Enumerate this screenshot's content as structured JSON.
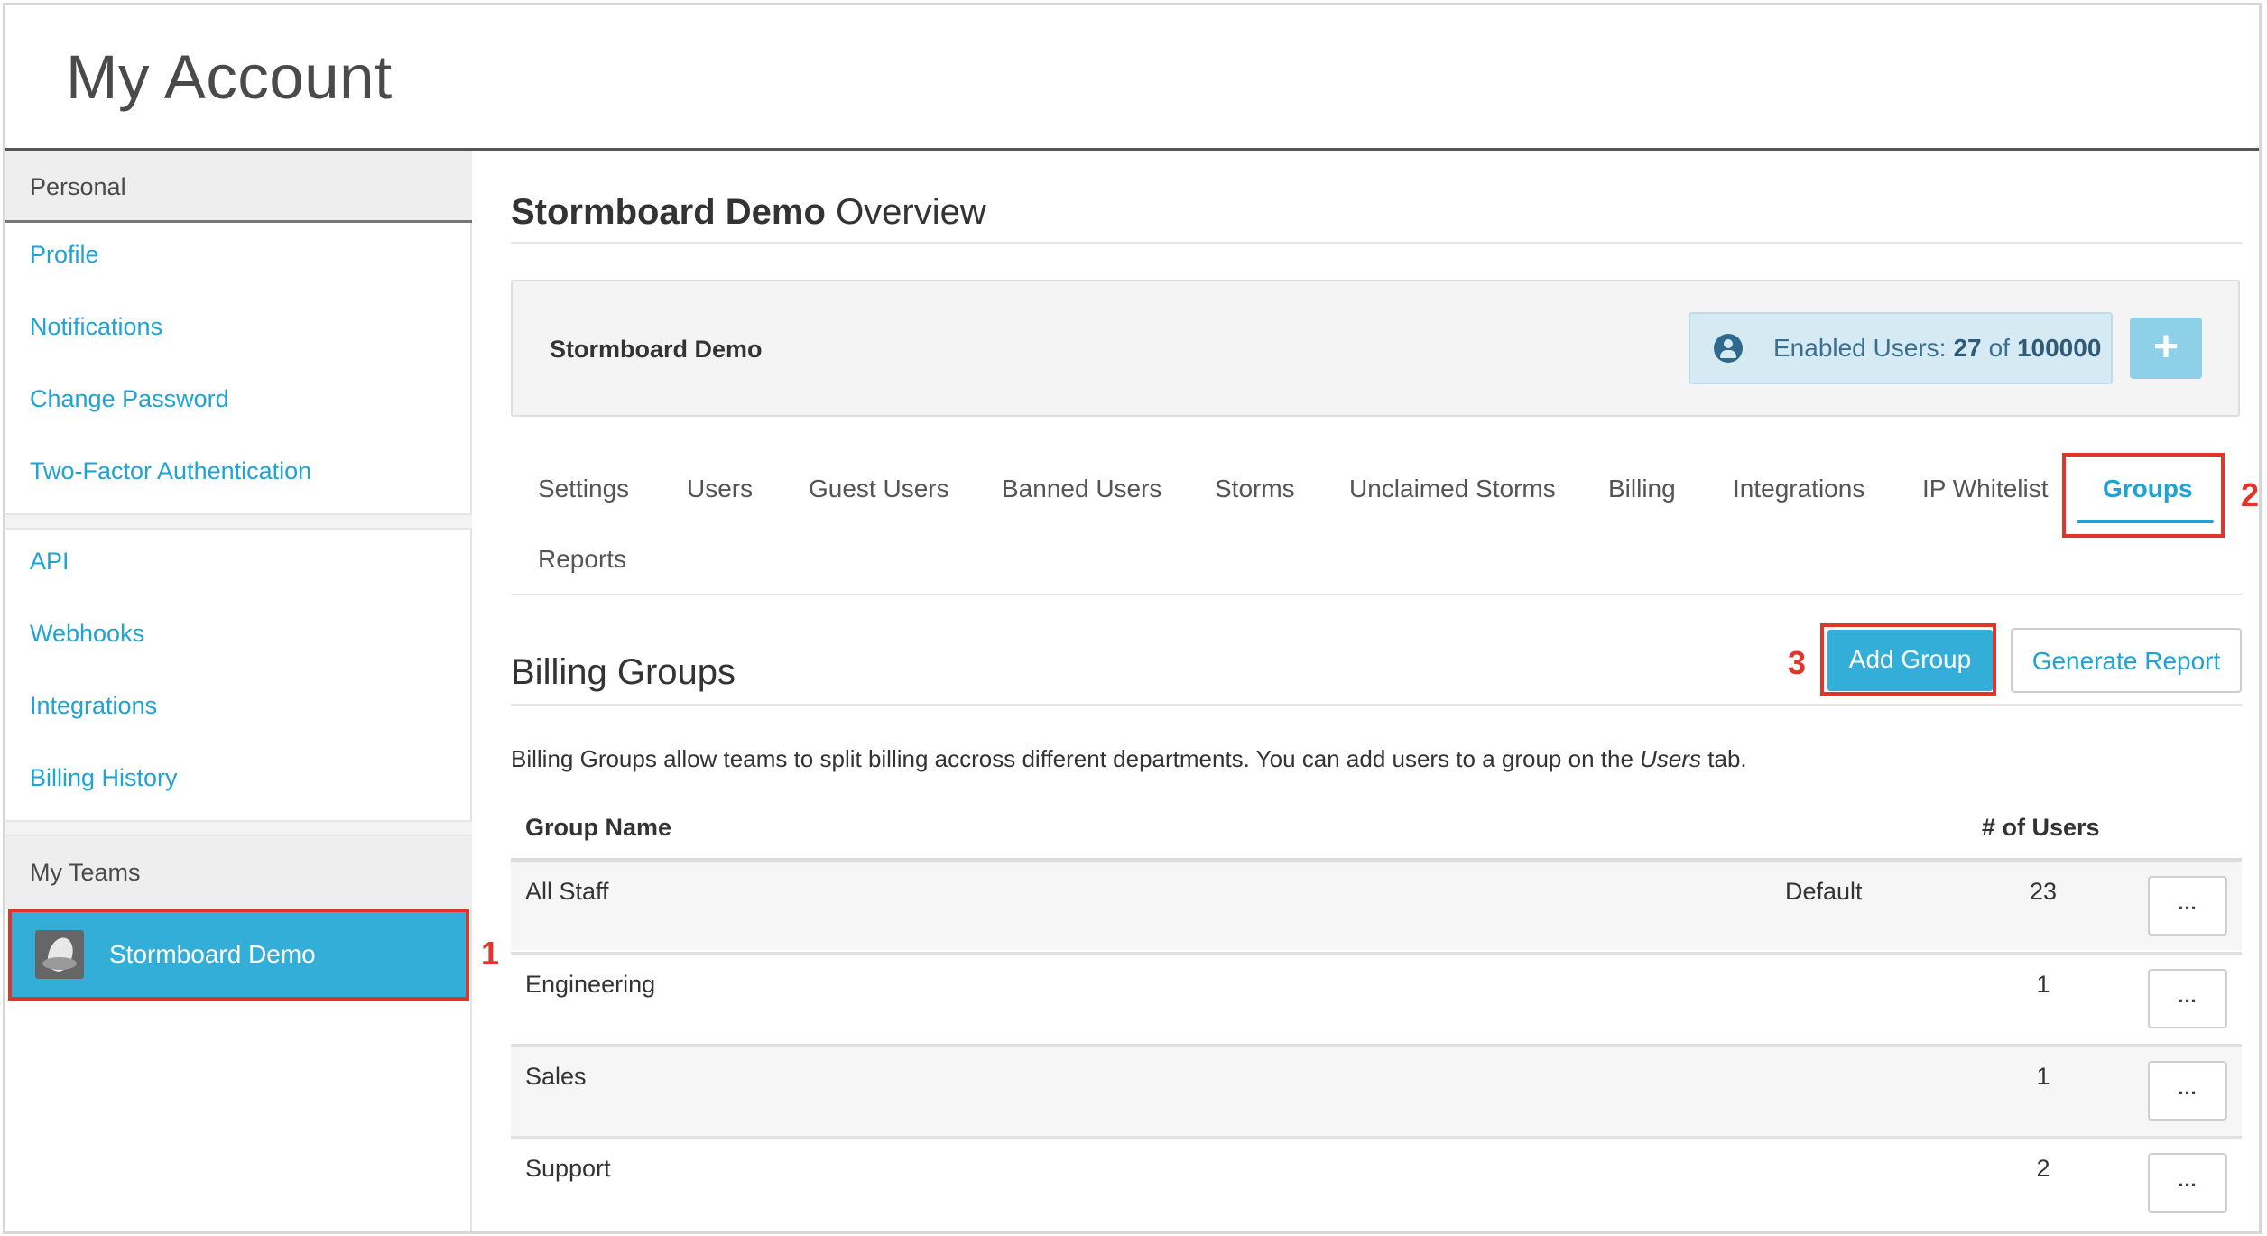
{
  "page": {
    "title": "My Account"
  },
  "sidebar": {
    "personal_header": "Personal",
    "personal_links": [
      "Profile",
      "Notifications",
      "Change Password",
      "Two-Factor Authentication"
    ],
    "dev_links": [
      "API",
      "Webhooks",
      "Integrations",
      "Billing History"
    ],
    "teams_header": "My Teams",
    "active_team": "Stormboard Demo"
  },
  "main": {
    "title_bold": "Stormboard Demo",
    "title_rest": "Overview",
    "summary": {
      "team_name": "Stormboard Demo",
      "enabled_label": "Enabled Users:",
      "enabled_count": "27",
      "of_label": "of",
      "enabled_total": "100000",
      "add_icon": "+"
    },
    "tabs": [
      "Settings",
      "Users",
      "Guest Users",
      "Banned Users",
      "Storms",
      "Unclaimed Storms",
      "Billing",
      "Integrations",
      "IP Whitelist",
      "Groups",
      "Reports"
    ],
    "active_tab": "Groups",
    "section_title": "Billing Groups",
    "add_group_label": "Add Group",
    "generate_report_label": "Generate Report",
    "description_pre": "Billing Groups allow teams to split billing accross different departments. You can add users to a group on the ",
    "description_em": "Users",
    "description_post": " tab.",
    "table": {
      "headers": {
        "name": "Group Name",
        "users": "# of Users"
      },
      "rows": [
        {
          "name": "All Staff",
          "tag": "Default",
          "users": "23",
          "menu": "..."
        },
        {
          "name": "Engineering",
          "tag": "",
          "users": "1",
          "menu": "..."
        },
        {
          "name": "Sales",
          "tag": "",
          "users": "1",
          "menu": "..."
        },
        {
          "name": "Support",
          "tag": "",
          "users": "2",
          "menu": "..."
        }
      ]
    }
  },
  "callouts": [
    "1",
    "2",
    "3"
  ],
  "colors": {
    "accent": "#33aed9",
    "link": "#1fa2d4",
    "highlight": "#e0352b"
  },
  "icons": {
    "user": "user-circle-icon",
    "add": "plus-icon",
    "more": "ellipsis-icon"
  }
}
